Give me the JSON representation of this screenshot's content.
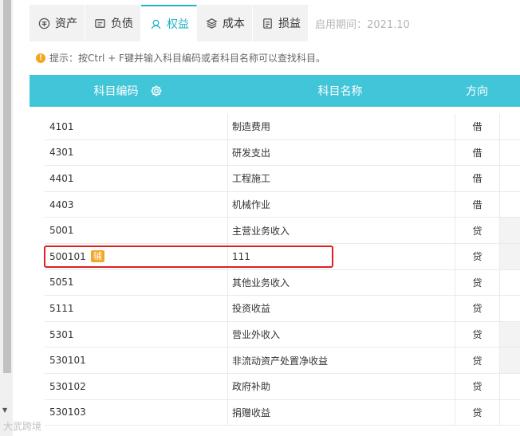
{
  "tabs": [
    {
      "label": "资产",
      "icon": "asset-icon"
    },
    {
      "label": "负债",
      "icon": "liability-icon"
    },
    {
      "label": "权益",
      "icon": "equity-icon",
      "active": true
    },
    {
      "label": "成本",
      "icon": "cost-icon"
    },
    {
      "label": "损益",
      "icon": "profit-loss-icon"
    }
  ],
  "enable_period": "启用期间：2021.10",
  "tip": "提示：按Ctrl + F键并输入科目编码或者科目名称可以查找科目。",
  "table": {
    "headers": {
      "code": "科目编码",
      "name": "科目名称",
      "direction": "方向"
    },
    "rows": [
      {
        "code": "4101",
        "name": "制造费用",
        "direction": "借"
      },
      {
        "code": "4301",
        "name": "研发支出",
        "direction": "借"
      },
      {
        "code": "4401",
        "name": "工程施工",
        "direction": "借"
      },
      {
        "code": "4403",
        "name": "机械作业",
        "direction": "借"
      },
      {
        "code": "5001",
        "name": "主营业务收入",
        "direction": "贷"
      },
      {
        "code": "500101",
        "badge": "辅",
        "name": "111",
        "direction": "贷"
      },
      {
        "code": "5051",
        "name": "其他业务收入",
        "direction": "贷"
      },
      {
        "code": "5111",
        "name": "投资收益",
        "direction": "贷"
      },
      {
        "code": "5301",
        "name": "营业外收入",
        "direction": "贷"
      },
      {
        "code": "530101",
        "name": "非流动资产处置净收益",
        "direction": "贷"
      },
      {
        "code": "530102",
        "name": "政府补助",
        "direction": "贷"
      },
      {
        "code": "530103",
        "name": "捐赠收益",
        "direction": "贷"
      }
    ]
  },
  "colors": {
    "accent": "#41c6d9",
    "badge": "#f5a623",
    "highlight": "#e02020"
  },
  "watermark": "大武跨境"
}
